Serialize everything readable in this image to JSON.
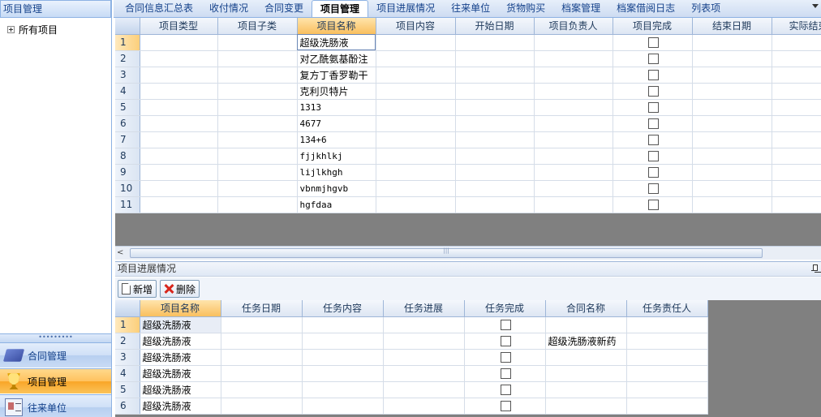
{
  "sidebar": {
    "title": "项目管理",
    "tree_root": "所有项目",
    "grip": "•••••••••",
    "nav": [
      {
        "label": "合同管理",
        "icon": "book-icon"
      },
      {
        "label": "项目管理",
        "icon": "trophy-icon",
        "active": true
      },
      {
        "label": "往来单位",
        "icon": "business-card-icon"
      }
    ]
  },
  "tabs": [
    {
      "label": "合同信息汇总表"
    },
    {
      "label": "收付情况"
    },
    {
      "label": "合同变更"
    },
    {
      "label": "项目管理",
      "active": true
    },
    {
      "label": "项目进展情况"
    },
    {
      "label": "往来单位"
    },
    {
      "label": "货物购买"
    },
    {
      "label": "档案管理"
    },
    {
      "label": "档案借阅日志"
    },
    {
      "label": "列表项"
    }
  ],
  "main_grid": {
    "columns": [
      "项目类型",
      "项目子类",
      "项目名称",
      "项目内容",
      "开始日期",
      "项目负责人",
      "项目完成",
      "结束日期",
      "实际结束"
    ],
    "selected_column": "项目名称",
    "rows": [
      {
        "num": "1",
        "name": "超级洗肠液",
        "done": false
      },
      {
        "num": "2",
        "name": "对乙酰氨基酚注",
        "done": false
      },
      {
        "num": "3",
        "name": "复方丁香罗勒干",
        "done": false
      },
      {
        "num": "4",
        "name": "克利贝特片",
        "done": false
      },
      {
        "num": "5",
        "name": "1313",
        "done": false
      },
      {
        "num": "6",
        "name": "4677",
        "done": false
      },
      {
        "num": "7",
        "name": "134+6",
        "done": false
      },
      {
        "num": "8",
        "name": "fjjkhlkj",
        "done": false
      },
      {
        "num": "9",
        "name": "lijlkhgh",
        "done": false
      },
      {
        "num": "10",
        "name": "vbnmjhgvb",
        "done": false
      },
      {
        "num": "11",
        "name": "hgfdaa",
        "done": false
      }
    ]
  },
  "scrollbar": {
    "left_arrow": "<"
  },
  "detail_panel": {
    "title": "项目进展情况",
    "toolbar": {
      "add_label": "新增",
      "delete_label": "删除"
    },
    "columns": [
      "项目名称",
      "任务日期",
      "任务内容",
      "任务进展",
      "任务完成",
      "合同名称",
      "任务责任人"
    ],
    "selected_column": "项目名称",
    "rows": [
      {
        "num": "1",
        "project": "超级洗肠液",
        "done": false,
        "contract": ""
      },
      {
        "num": "2",
        "project": "超级洗肠液",
        "done": false,
        "contract": "超级洗肠液新药"
      },
      {
        "num": "3",
        "project": "超级洗肠液",
        "done": false,
        "contract": ""
      },
      {
        "num": "4",
        "project": "超级洗肠液",
        "done": false,
        "contract": ""
      },
      {
        "num": "5",
        "project": "超级洗肠液",
        "done": false,
        "contract": ""
      },
      {
        "num": "6",
        "project": "超级洗肠液",
        "done": false,
        "contract": ""
      }
    ]
  }
}
